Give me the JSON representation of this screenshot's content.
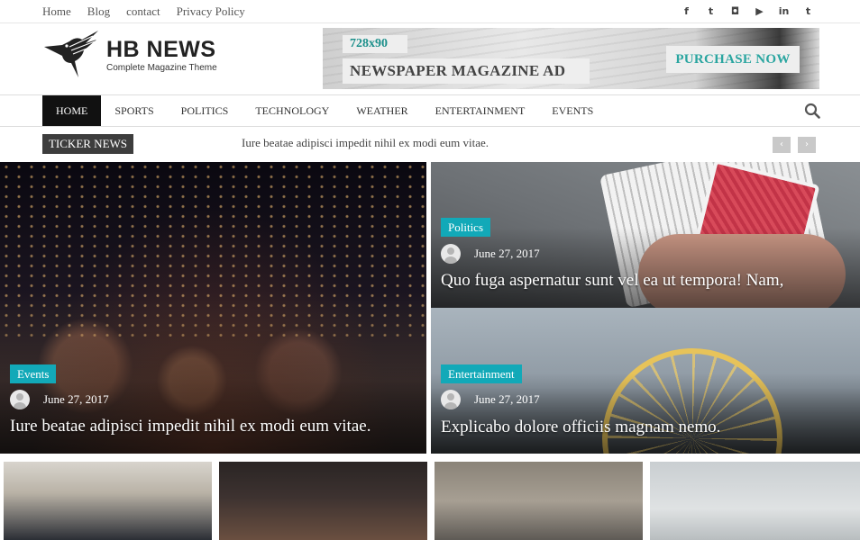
{
  "topbar": {
    "links": [
      "Home",
      "Blog",
      "contact",
      "Privacy Policy"
    ],
    "social_icons": [
      {
        "name": "facebook-icon",
        "glyph": "f"
      },
      {
        "name": "twitter-icon",
        "glyph": "t"
      },
      {
        "name": "instagram-icon",
        "glyph": "◘"
      },
      {
        "name": "youtube-icon",
        "glyph": "▶"
      },
      {
        "name": "linkedin-icon",
        "glyph": "in"
      },
      {
        "name": "tumblr-icon",
        "glyph": "t"
      }
    ]
  },
  "brand": {
    "title": "HB NEWS",
    "tagline": "Complete Magazine Theme"
  },
  "ad": {
    "size": "728x90",
    "title": "NEWSPAPER MAGAZINE AD",
    "cta": "PURCHASE NOW"
  },
  "nav": {
    "items": [
      "HOME",
      "SPORTS",
      "POLITICS",
      "TECHNOLOGY",
      "WEATHER",
      "ENTERTAINMENT",
      "EVENTS"
    ],
    "active": "HOME"
  },
  "ticker": {
    "label": "TICKER NEWS",
    "text": "Iure beatae adipisci impedit nihil ex modi eum vitae.",
    "prev": "‹",
    "next": "›"
  },
  "featured": [
    {
      "category": "Events",
      "date": "June 27, 2017",
      "title": "Iure beatae adipisci impedit nihil ex modi eum vitae."
    },
    {
      "category": "Politics",
      "date": "June 27, 2017",
      "title": "Quo fuga aspernatur sunt vel ea ut tempora! Nam,"
    },
    {
      "category": "Entertainment",
      "date": "June 27, 2017",
      "title": "Explicabo dolore officiis magnam nemo."
    }
  ],
  "colors": {
    "accent": "#12a9b8",
    "nav_active_bg": "#111111",
    "ticker_label_bg": "#3d3d3d"
  }
}
